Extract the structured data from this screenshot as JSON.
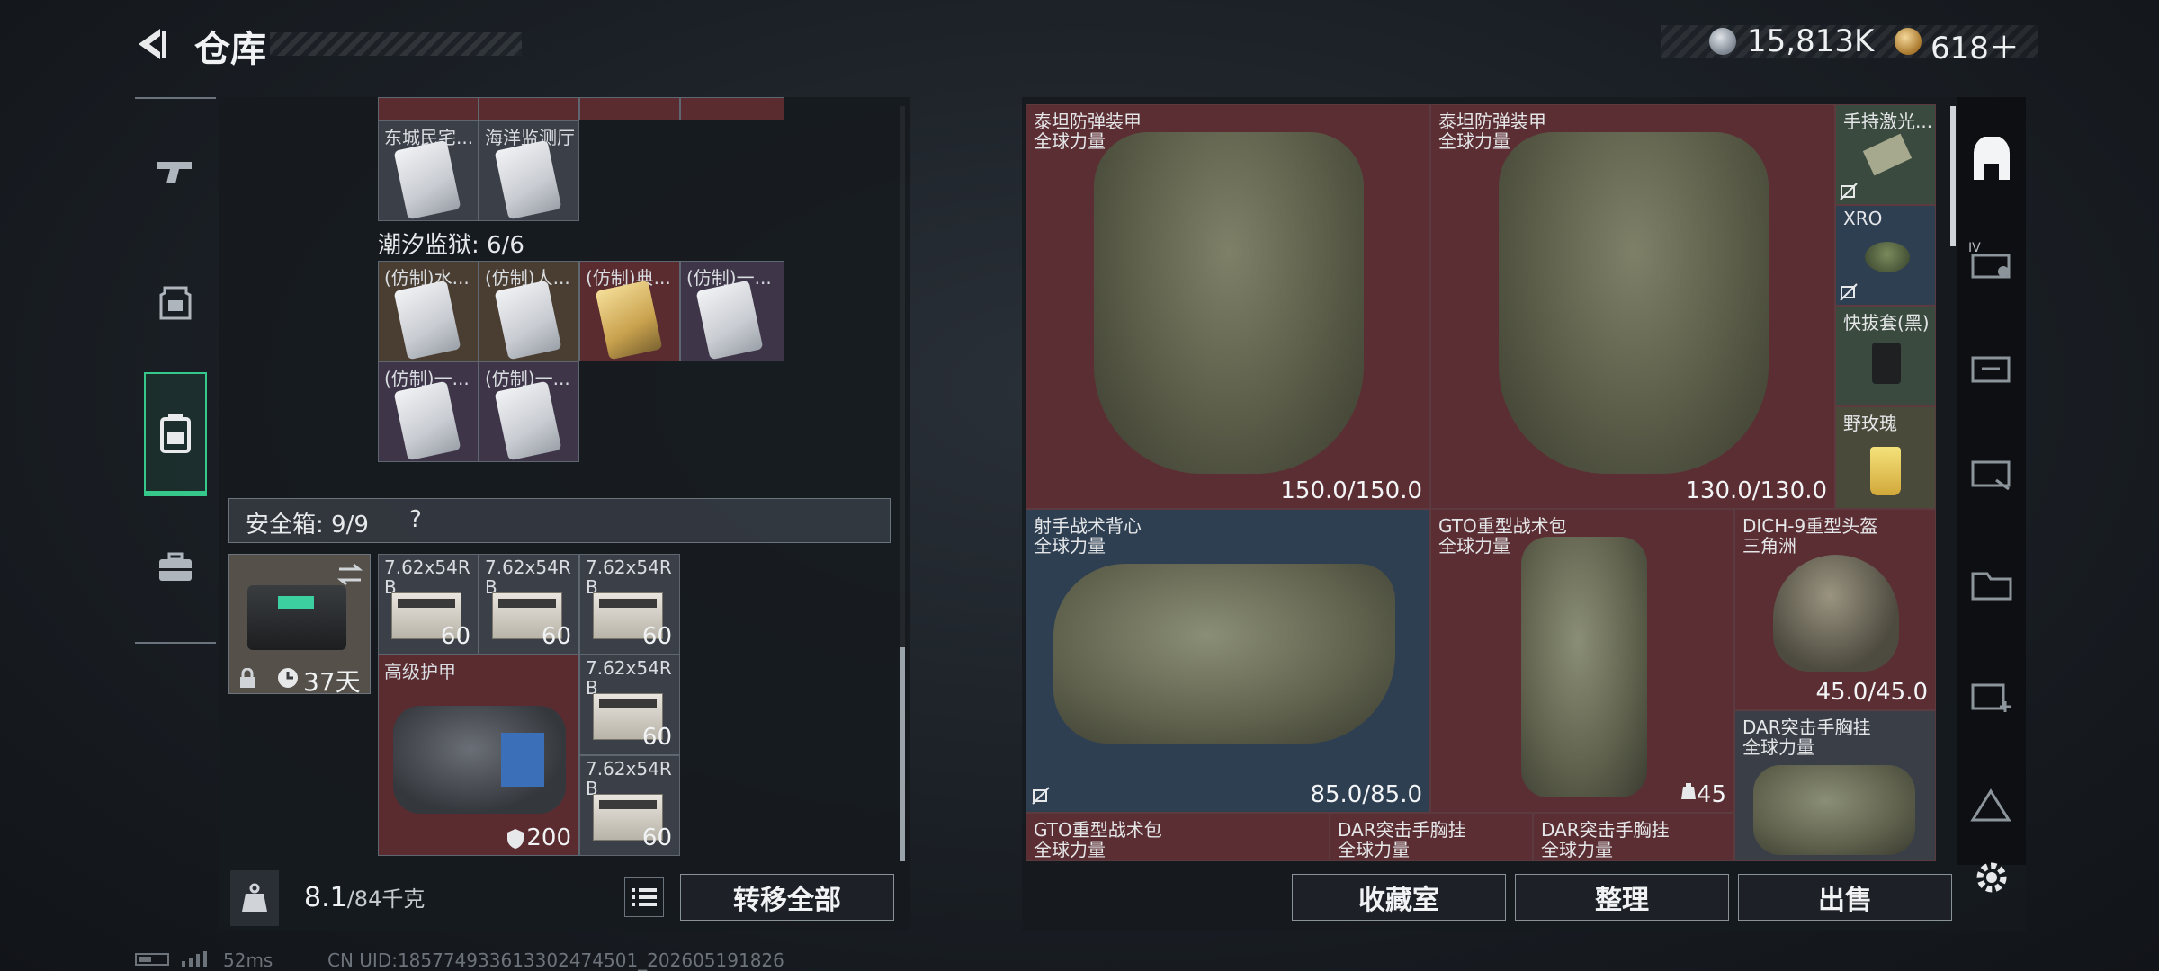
{
  "header": {
    "title": "仓库",
    "currency_silver": "15,813K",
    "currency_gold": "618＋"
  },
  "left_nav": {
    "items": [
      "gun-icon",
      "armor-icon",
      "backpack-icon",
      "toolbox-icon"
    ],
    "active": "backpack-icon"
  },
  "left_panel": {
    "top_cards": [
      {
        "label": "东城民宅..."
      },
      {
        "label": "海洋监测厅"
      }
    ],
    "prison_title": "潮汐监狱: 6/6",
    "prison_cards": [
      {
        "label": "(仿制)水..."
      },
      {
        "label": "(仿制)人..."
      },
      {
        "label": "(仿制)典..."
      },
      {
        "label": "(仿制)一..."
      },
      {
        "label": "(仿制)一..."
      },
      {
        "label": "(仿制)一..."
      }
    ],
    "safebox_title": "安全箱: 9/9",
    "safebox_help": "?",
    "safebox_days": "37天",
    "ammo": [
      {
        "name": "7.62x54R",
        "sub": "B",
        "qty": "60"
      },
      {
        "name": "7.62x54R",
        "sub": "B",
        "qty": "60"
      },
      {
        "name": "7.62x54R",
        "sub": "B",
        "qty": "60"
      },
      {
        "name": "7.62x54R",
        "sub": "B",
        "qty": "60"
      },
      {
        "name": "7.62x54R",
        "sub": "B",
        "qty": "60"
      }
    ],
    "armor_bag": {
      "name": "高级护甲",
      "value": "200"
    },
    "weight_current": "8.1",
    "weight_max": "/84千克",
    "transfer_all": "转移全部"
  },
  "right_panel": {
    "items": [
      {
        "n1": "泰坦防弹装甲",
        "n2": "全球力量",
        "dur": "150.0/150.0"
      },
      {
        "n1": "泰坦防弹装甲",
        "n2": "全球力量",
        "dur": "130.0/130.0"
      },
      {
        "n1": "手持激光...",
        "n2": ""
      },
      {
        "n1": "XRO",
        "n2": ""
      },
      {
        "n1": "快拔套(黑)",
        "n2": ""
      },
      {
        "n1": "野玫瑰",
        "n2": ""
      },
      {
        "n1": "射手战术背心",
        "n2": "全球力量",
        "dur": "85.0/85.0"
      },
      {
        "n1": "GTO重型战术包",
        "n2": "全球力量",
        "dur": "45"
      },
      {
        "n1": "DICH-9重型头盔",
        "n2": "三角洲",
        "dur": "45.0/45.0"
      },
      {
        "n1": "DAR突击手胸挂",
        "n2": "全球力量"
      },
      {
        "n1": "GTO重型战术包",
        "n2": "全球力量"
      },
      {
        "n1": "DAR突击手胸挂",
        "n2": "全球力量"
      },
      {
        "n1": "DAR突击手胸挂",
        "n2": "全球力量"
      }
    ],
    "buttons": {
      "collection": "收藏室",
      "sort": "整理",
      "sell": "出售"
    }
  },
  "status": {
    "ping": "52ms",
    "uid": "CN UID:18577493361330247450​1_202605191826"
  },
  "colors": {
    "accent_green": "#36c78a",
    "cell_red": "#5b2e33",
    "cell_blue": "#2e3f52"
  }
}
